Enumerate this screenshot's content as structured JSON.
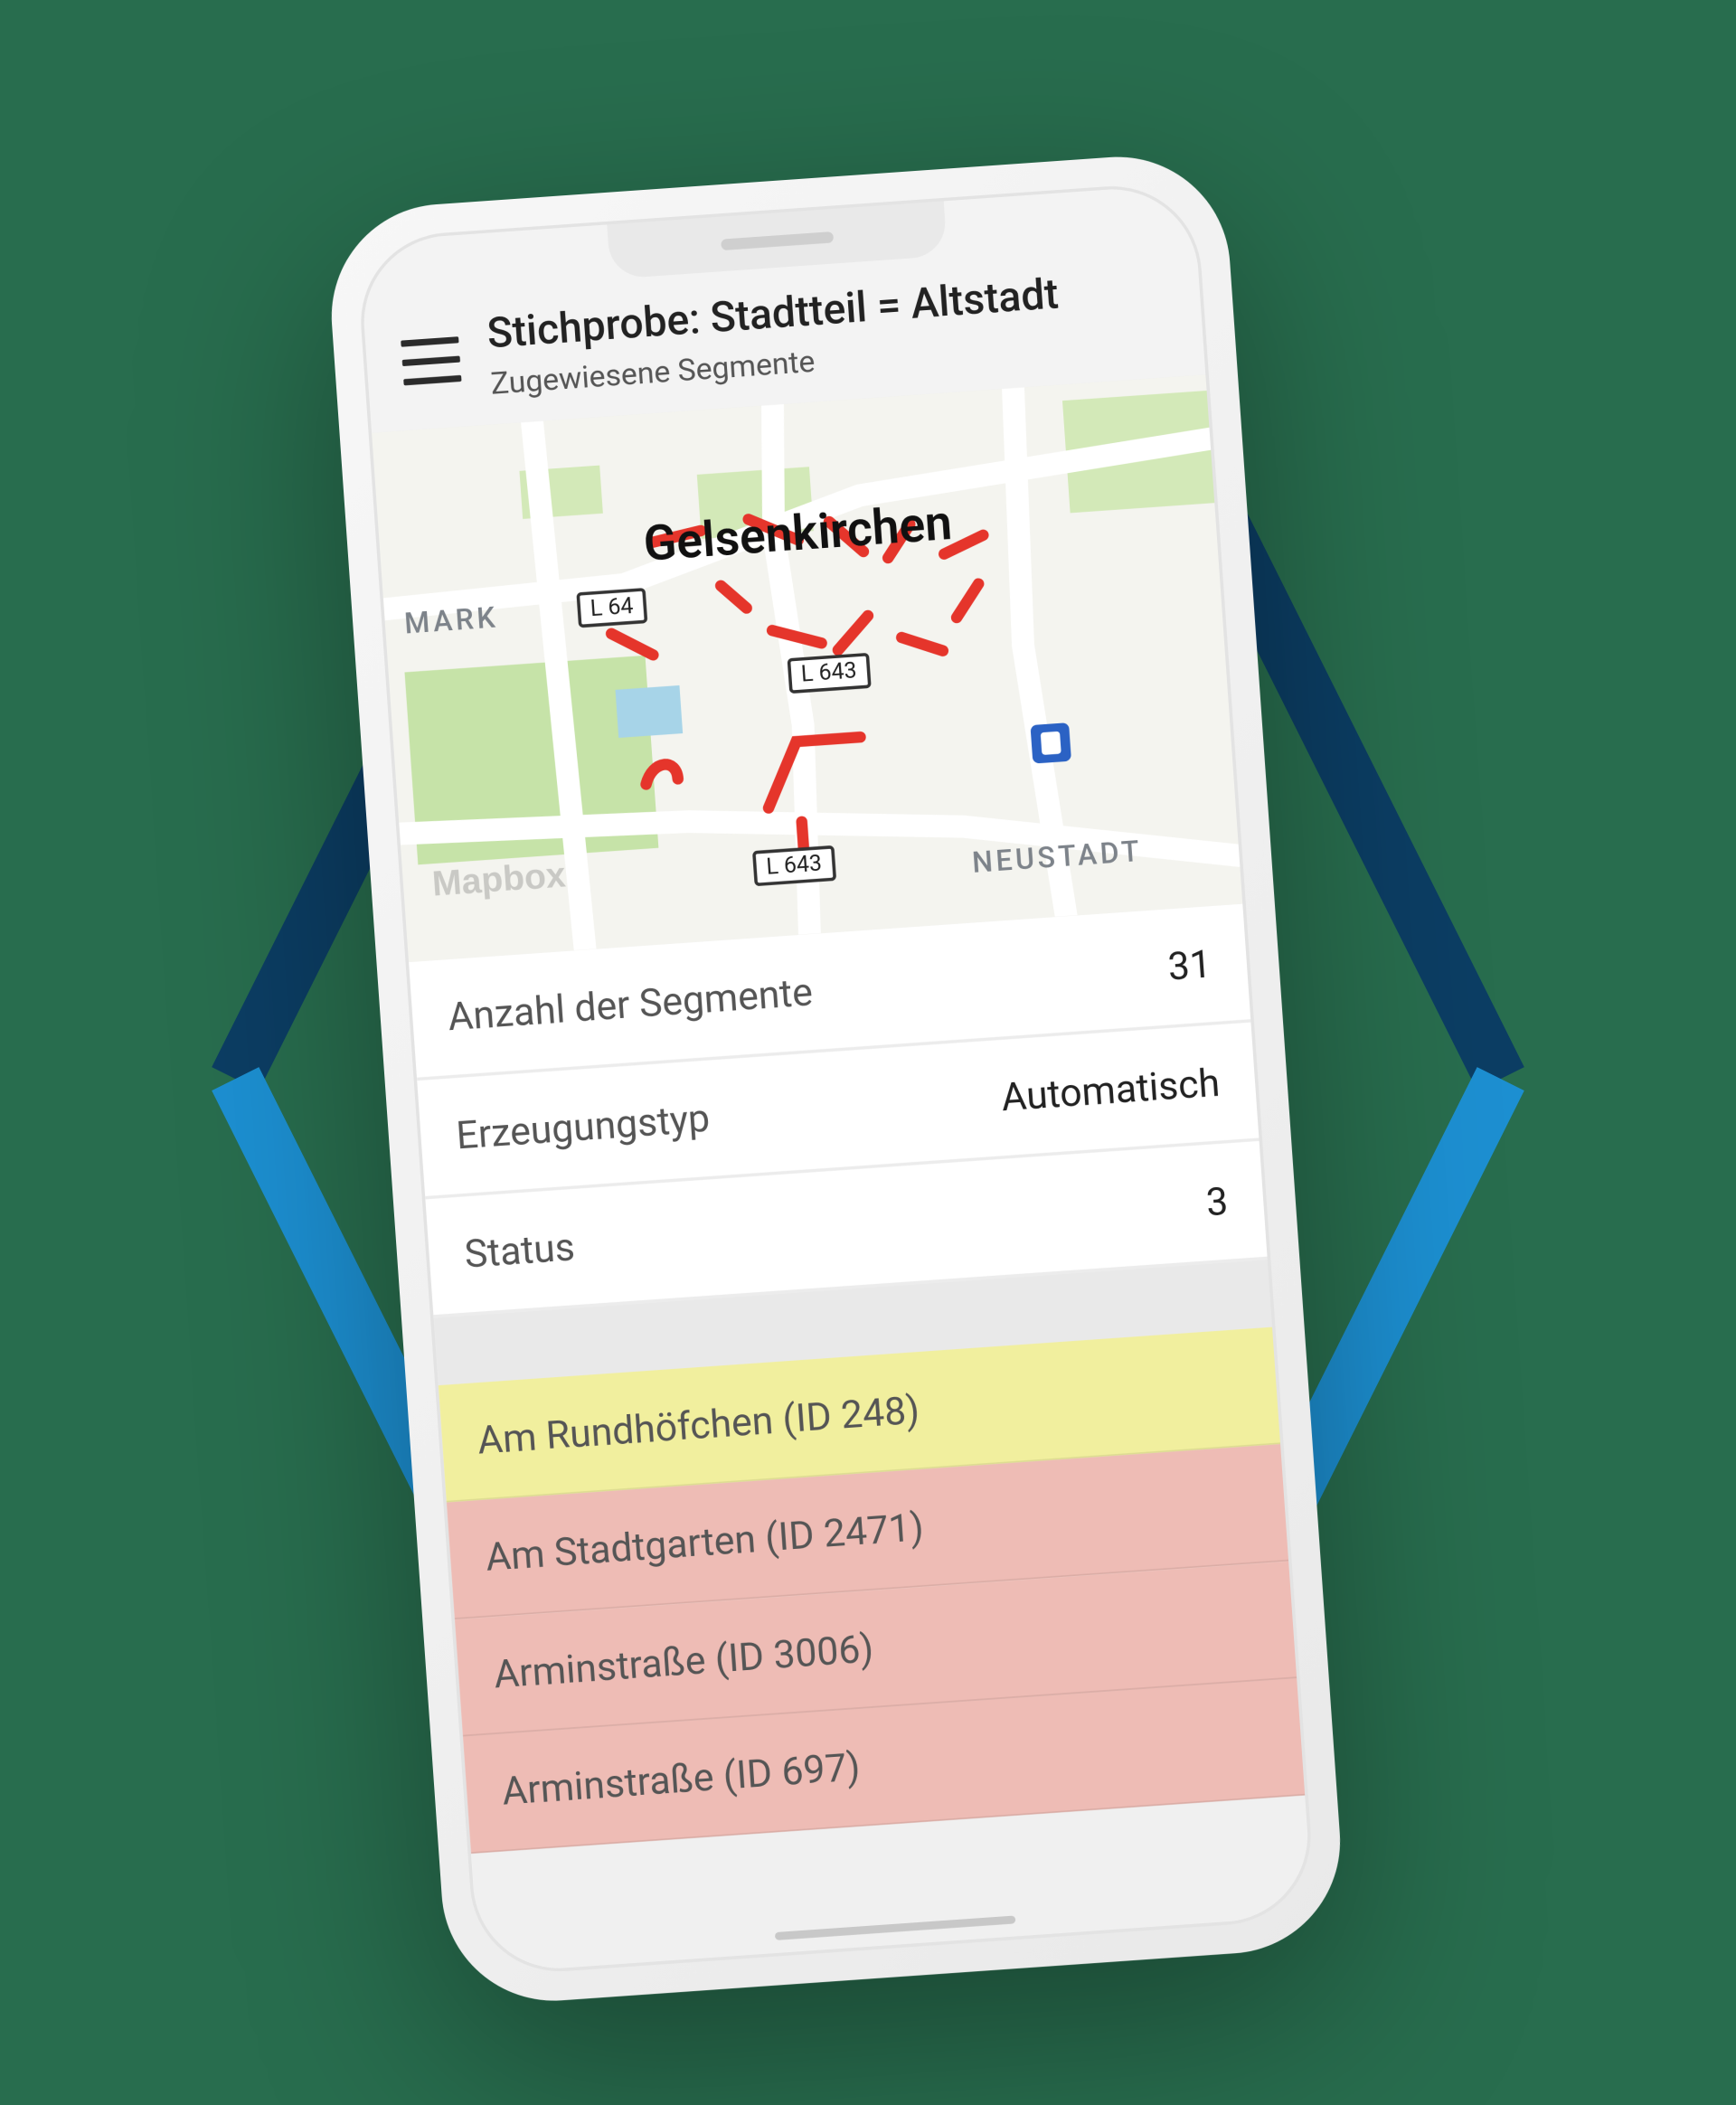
{
  "header": {
    "title": "Stichprobe: Stadtteil = Altstadt",
    "subtitle": "Zugewiesene Segmente"
  },
  "map": {
    "city_label": "Gelsenkirchen",
    "district_label": "NEUSTADT",
    "mark_label": "MARK",
    "attribution": "Mapbox",
    "road_shields": [
      "L 64",
      "L 643",
      "L 643"
    ]
  },
  "info": {
    "segments_label": "Anzahl der Segmente",
    "segments_value": "31",
    "gen_type_label": "Erzeugungstyp",
    "gen_type_value": "Automatisch",
    "status_label": "Status",
    "status_value": "3"
  },
  "segments": [
    {
      "label": "Am Rundhöfchen (ID 248)",
      "color": "yellow"
    },
    {
      "label": "Am Stadtgarten (ID 2471)",
      "color": "pink"
    },
    {
      "label": "Arminstraße (ID 3006)",
      "color": "pink"
    },
    {
      "label": "Arminstraße (ID 697)",
      "color": "pink"
    }
  ],
  "colors": {
    "background": "#286d4e",
    "hex_top": "#0b3d63",
    "hex_bottom": "#1c8fd1",
    "seg_yellow": "#f1ef9e",
    "seg_pink": "#eebcb5",
    "route_red": "#e5352b"
  }
}
